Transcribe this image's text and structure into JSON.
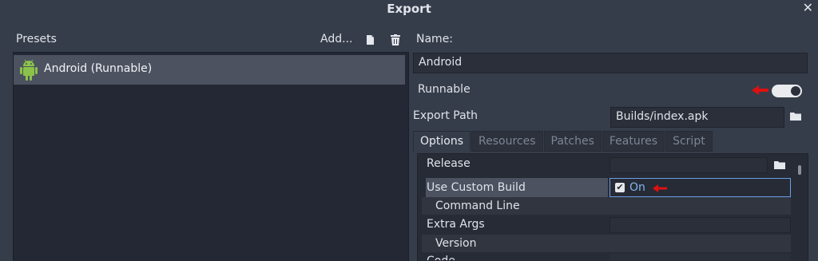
{
  "window": {
    "title": "Export"
  },
  "left": {
    "presets_label": "Presets",
    "add_label": "Add...",
    "presets": [
      {
        "label": "Android (Runnable)",
        "selected": true
      }
    ]
  },
  "right": {
    "name_label": "Name:",
    "name_value": "Android",
    "runnable_label": "Runnable",
    "runnable_on": true,
    "export_path_label": "Export Path",
    "export_path_value": "Builds/index.apk",
    "tabs": [
      {
        "label": "Options",
        "active": true
      },
      {
        "label": "Resources",
        "active": false
      },
      {
        "label": "Patches",
        "active": false
      },
      {
        "label": "Features",
        "active": false
      },
      {
        "label": "Script",
        "active": false
      }
    ],
    "options": {
      "release_label": "Release",
      "use_custom_build_label": "Use Custom Build",
      "use_custom_build_value": "On",
      "command_line_label": "Command Line",
      "extra_args_label": "Extra Args",
      "version_label": "Version",
      "code_label": "Code"
    }
  },
  "colors": {
    "background": "#363d4a",
    "selection": "#4c5260",
    "accent_blue": "#6d9ee8",
    "annotation_red": "#e01010",
    "android_green": "#8bc34a"
  },
  "icons": [
    "close-icon",
    "duplicate-icon",
    "trash-icon",
    "android-icon",
    "folder-icon",
    "checkmark-icon",
    "annotation-arrow-icon"
  ]
}
